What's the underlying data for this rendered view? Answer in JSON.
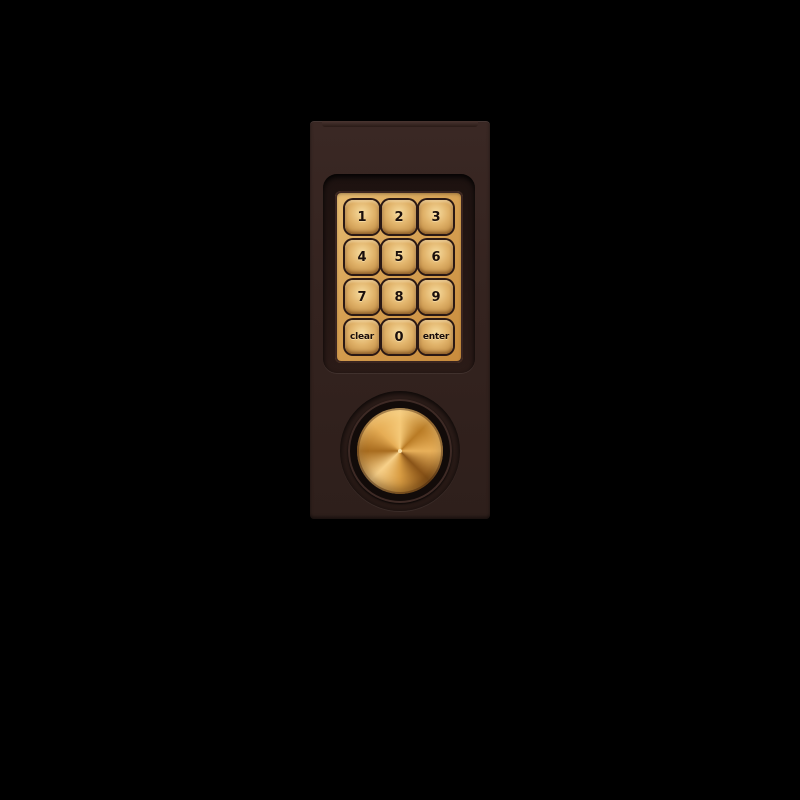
{
  "device": {
    "colors": {
      "body": "#34231f",
      "brass": "#d6a052",
      "background": "#000000"
    },
    "keypad": {
      "keys": [
        {
          "label": "1",
          "icon": "none"
        },
        {
          "label": "2",
          "icon": "none"
        },
        {
          "label": "3",
          "icon": "none"
        },
        {
          "label": "4",
          "icon": "none"
        },
        {
          "label": "5",
          "icon": "none"
        },
        {
          "label": "6",
          "icon": "none"
        },
        {
          "label": "7",
          "icon": "none"
        },
        {
          "label": "8",
          "icon": "none"
        },
        {
          "label": "9",
          "icon": "none"
        },
        {
          "label": "clear",
          "icon": "none"
        },
        {
          "label": "0",
          "icon": "none"
        },
        {
          "label": "enter",
          "icon": "none"
        }
      ]
    },
    "knob": {
      "icon": "brushed-brass-knob"
    }
  }
}
